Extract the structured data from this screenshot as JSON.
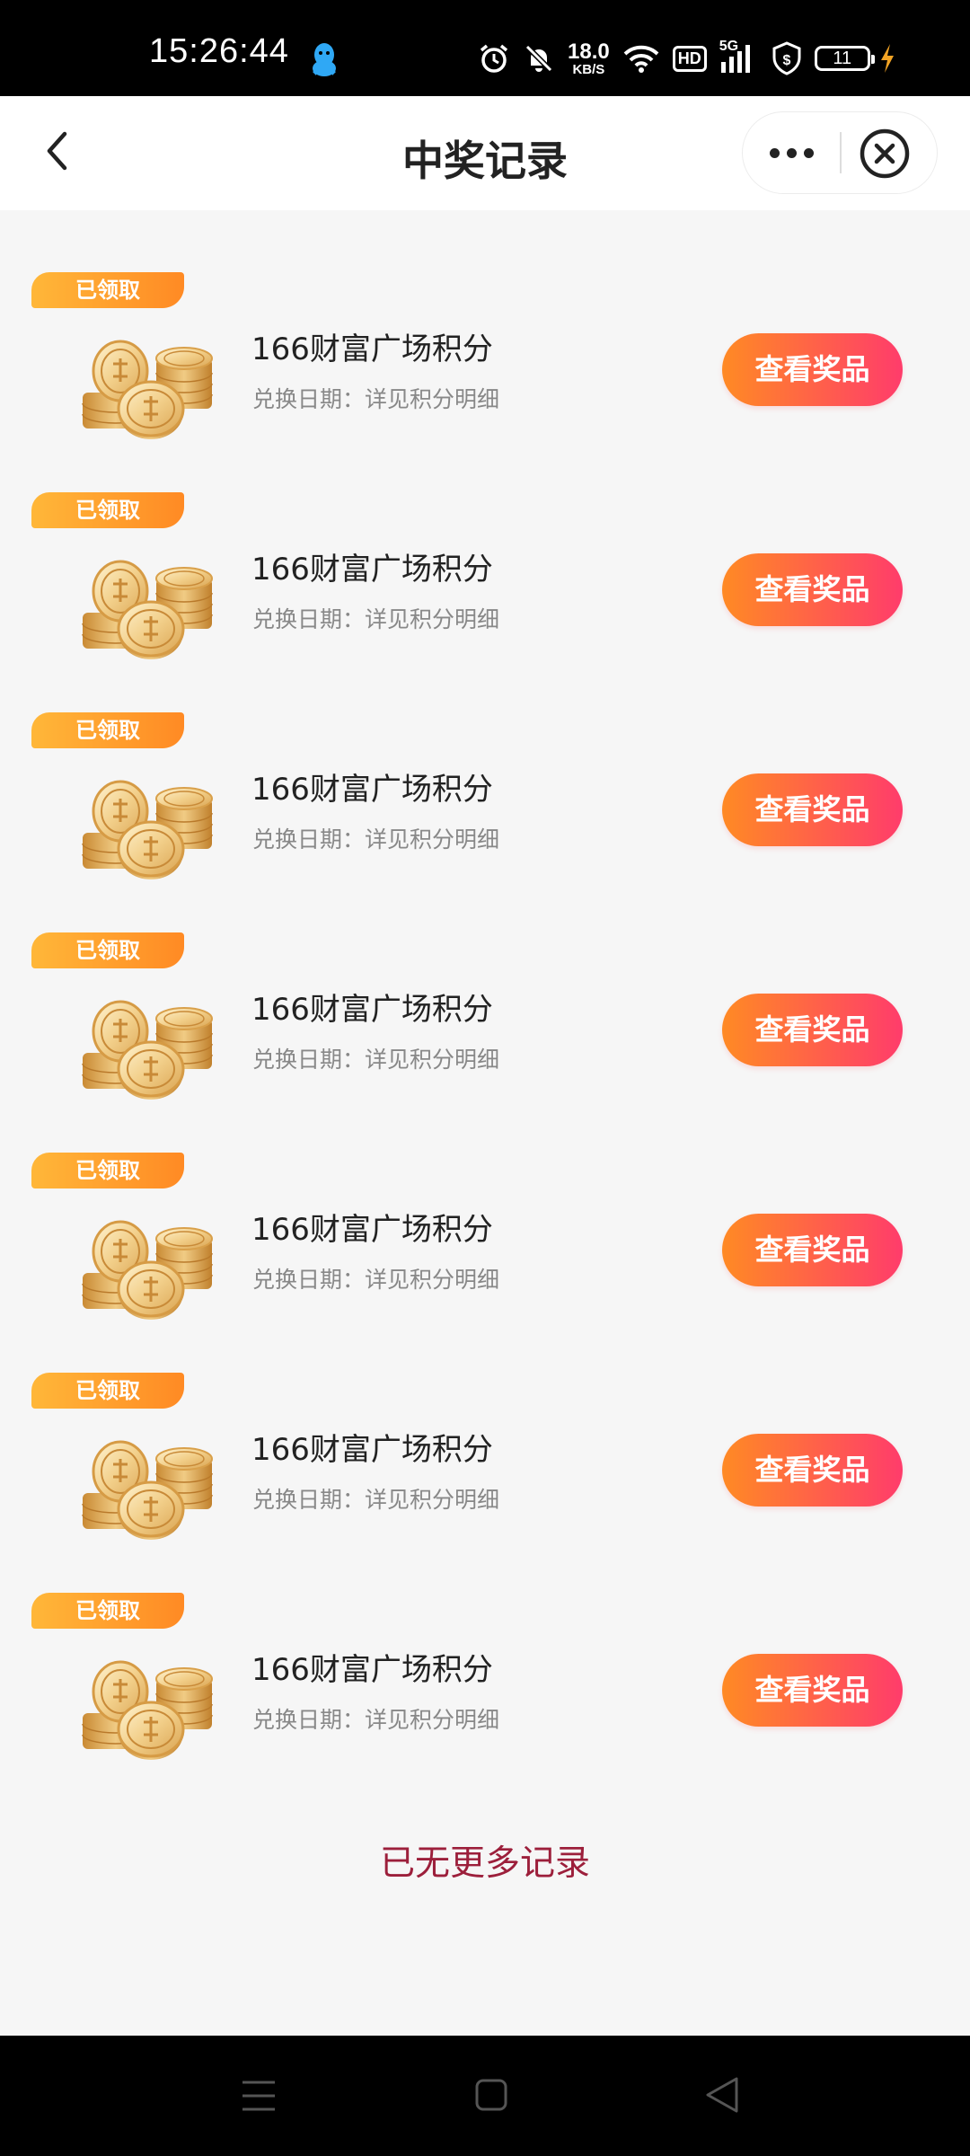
{
  "status_bar": {
    "time": "15:26:44",
    "net_speed_value": "18.0",
    "net_speed_unit": "KB/S",
    "hd_label": "HD",
    "signal_label": "5G",
    "battery_level": "11",
    "icons": [
      "qq-icon",
      "alarm-icon",
      "mute-icon",
      "wifi-icon",
      "hd-icon",
      "signal-icon",
      "shield-dollar-icon",
      "battery-icon",
      "charging-icon"
    ]
  },
  "header": {
    "title": "中奖记录",
    "icons": [
      "back-chevron-icon",
      "more-dots-icon",
      "close-circle-icon"
    ]
  },
  "records": [
    {
      "badge": "已领取",
      "title": "166财富广场积分",
      "subtitle": "兑换日期：详见积分明细",
      "button": "查看奖品"
    },
    {
      "badge": "已领取",
      "title": "166财富广场积分",
      "subtitle": "兑换日期：详见积分明细",
      "button": "查看奖品"
    },
    {
      "badge": "已领取",
      "title": "166财富广场积分",
      "subtitle": "兑换日期：详见积分明细",
      "button": "查看奖品"
    },
    {
      "badge": "已领取",
      "title": "166财富广场积分",
      "subtitle": "兑换日期：详见积分明细",
      "button": "查看奖品"
    },
    {
      "badge": "已领取",
      "title": "166财富广场积分",
      "subtitle": "兑换日期：详见积分明细",
      "button": "查看奖品"
    },
    {
      "badge": "已领取",
      "title": "166财富广场积分",
      "subtitle": "兑换日期：详见积分明细",
      "button": "查看奖品"
    },
    {
      "badge": "已领取",
      "title": "166财富广场积分",
      "subtitle": "兑换日期：详见积分明细",
      "button": "查看奖品"
    }
  ],
  "footer_text": "已无更多记录",
  "colors": {
    "badge_gradient": [
      "#ffb739",
      "#ff8a24"
    ],
    "button_gradient": [
      "#ff8a24",
      "#ff3c6b"
    ],
    "footer_text": "#9c1f3b",
    "page_background": "#f6f6f6"
  },
  "nav_bar": {
    "icons": [
      "menu-icon",
      "home-square-icon",
      "back-triangle-icon"
    ]
  }
}
